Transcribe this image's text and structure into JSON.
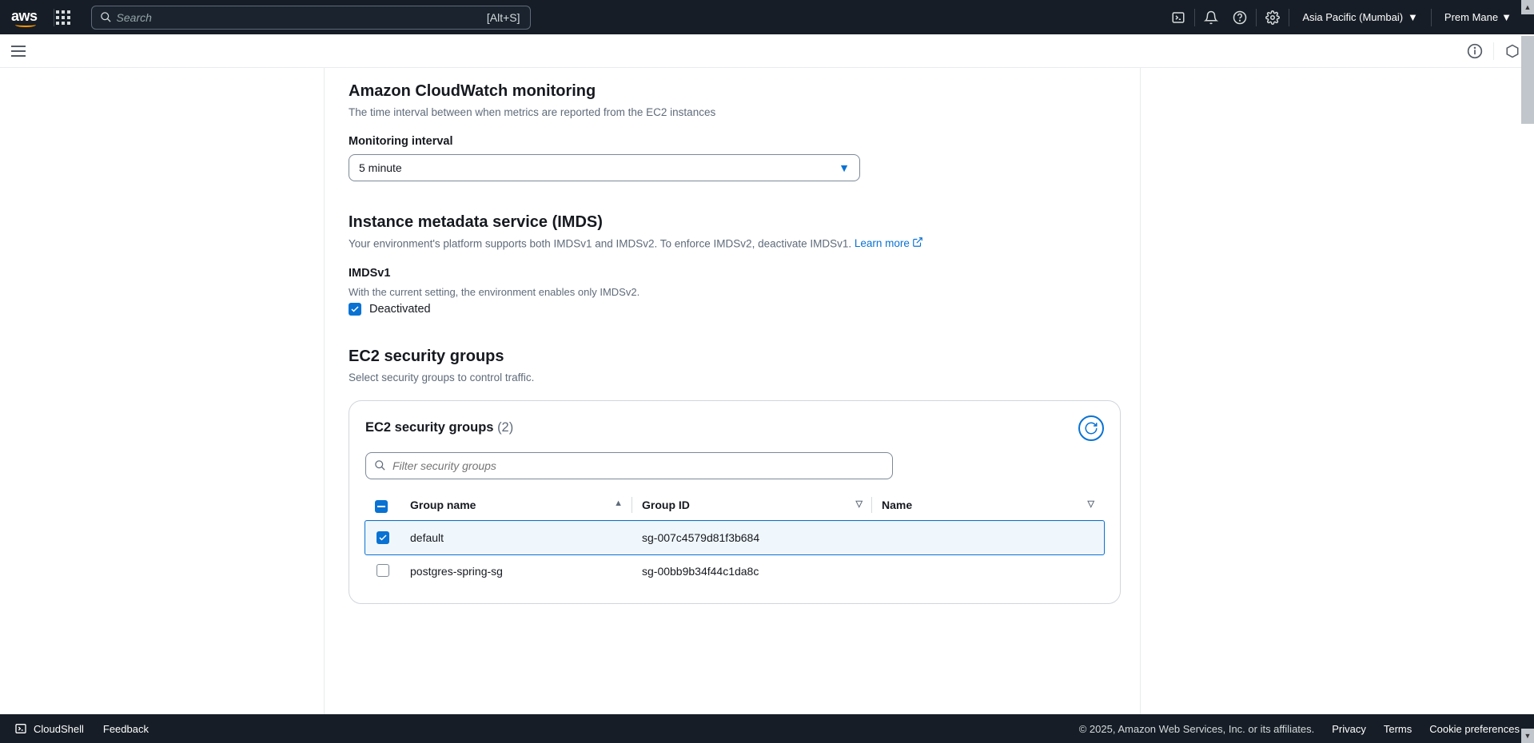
{
  "header": {
    "logo": "aws",
    "search_placeholder": "Search",
    "search_shortcut": "[Alt+S]",
    "region": "Asia Pacific (Mumbai)",
    "user": "Prem Mane"
  },
  "sections": {
    "cloudwatch": {
      "title": "Amazon CloudWatch monitoring",
      "desc": "The time interval between when metrics are reported from the EC2 instances",
      "field_label": "Monitoring interval",
      "selected": "5 minute"
    },
    "imds": {
      "title": "Instance metadata service (IMDS)",
      "desc": "Your environment's platform supports both IMDSv1 and IMDSv2. To enforce IMDSv2, deactivate IMDSv1. ",
      "learn_more": "Learn more",
      "field_label": "IMDSv1",
      "field_hint": "With the current setting, the environment enables only IMDSv2.",
      "checkbox_label": "Deactivated"
    },
    "sg": {
      "title": "EC2 security groups",
      "desc": "Select security groups to control traffic.",
      "panel_title": "EC2 security groups",
      "count": "(2)",
      "filter_placeholder": "Filter security groups",
      "columns": {
        "c1": "Group name",
        "c2": "Group ID",
        "c3": "Name"
      },
      "rows": [
        {
          "group_name": "default",
          "group_id": "sg-007c4579d81f3b684",
          "name": "",
          "selected": true
        },
        {
          "group_name": "postgres-spring-sg",
          "group_id": "sg-00bb9b34f44c1da8c",
          "name": "",
          "selected": false
        }
      ]
    }
  },
  "footer": {
    "cloudshell": "CloudShell",
    "feedback": "Feedback",
    "copyright": "© 2025, Amazon Web Services, Inc. or its affiliates.",
    "privacy": "Privacy",
    "terms": "Terms",
    "cookies": "Cookie preferences"
  }
}
